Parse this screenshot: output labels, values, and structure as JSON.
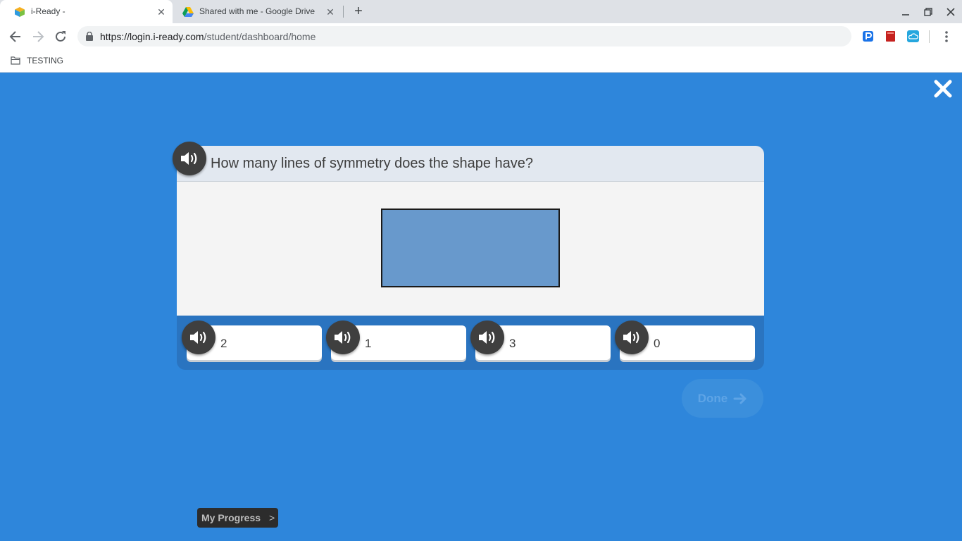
{
  "browser": {
    "tabs": [
      {
        "title": "i-Ready -",
        "active": true
      },
      {
        "title": "Shared with me - Google Drive",
        "active": false
      }
    ],
    "url": {
      "domain": "https://login.i-ready.com",
      "path": "/student/dashboard/home"
    },
    "bookmarks": [
      {
        "label": "TESTING"
      }
    ]
  },
  "question": {
    "prompt": "How many lines of symmetry does the shape have?",
    "shape": {
      "type": "rectangle",
      "fill": "#6899cc",
      "border": "#1a1a1a"
    }
  },
  "answers": [
    {
      "label": "2"
    },
    {
      "label": "1"
    },
    {
      "label": "3"
    },
    {
      "label": "0"
    }
  ],
  "done_label": "Done",
  "my_progress": {
    "label": "My Progress",
    "chevron": ">"
  },
  "colors": {
    "background": "#2e86db",
    "card_header": "#e2e8f0",
    "speaker": "#3f3f3f"
  }
}
